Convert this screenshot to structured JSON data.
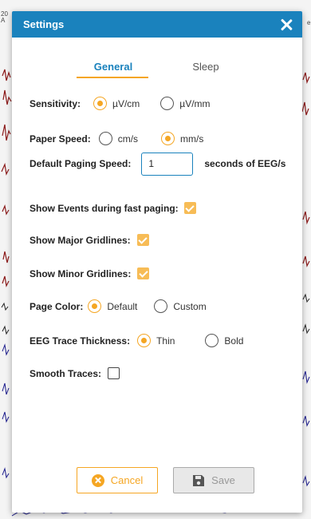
{
  "background": {
    "date_fragment_top": "20",
    "date_fragment_bottom": "A",
    "right_fragment": "e"
  },
  "dialog": {
    "title": "Settings",
    "close_icon": "close-icon",
    "title_color": "#1a82bd"
  },
  "tabs": [
    {
      "label": "General",
      "active": true
    },
    {
      "label": "Sleep",
      "active": false
    }
  ],
  "settings": {
    "sensitivity": {
      "label": "Sensitivity:",
      "options": [
        "µV/cm",
        "µV/mm"
      ],
      "selected": "µV/cm"
    },
    "paper_speed": {
      "label": "Paper Speed:",
      "options": [
        "cm/s",
        "mm/s"
      ],
      "selected": "mm/s"
    },
    "default_paging_speed": {
      "label": "Default Paging Speed:",
      "value": "1",
      "suffix": "seconds of EEG/s"
    },
    "show_events_fast_paging": {
      "label": "Show Events during fast paging:",
      "checked": true
    },
    "show_major_gridlines": {
      "label": "Show Major Gridlines:",
      "checked": true
    },
    "show_minor_gridlines": {
      "label": "Show Minor Gridlines:",
      "checked": true
    },
    "page_color": {
      "label": "Page Color:",
      "options": [
        "Default",
        "Custom"
      ],
      "selected": "Default"
    },
    "eeg_trace_thickness": {
      "label": "EEG Trace Thickness:",
      "options": [
        "Thin",
        "Bold"
      ],
      "selected": "Thin"
    },
    "smooth_traces": {
      "label": "Smooth Traces:",
      "checked": false
    }
  },
  "buttons": {
    "cancel": "Cancel",
    "save": "Save"
  },
  "colors": {
    "accent": "#f5a623",
    "header": "#1a82bd"
  }
}
